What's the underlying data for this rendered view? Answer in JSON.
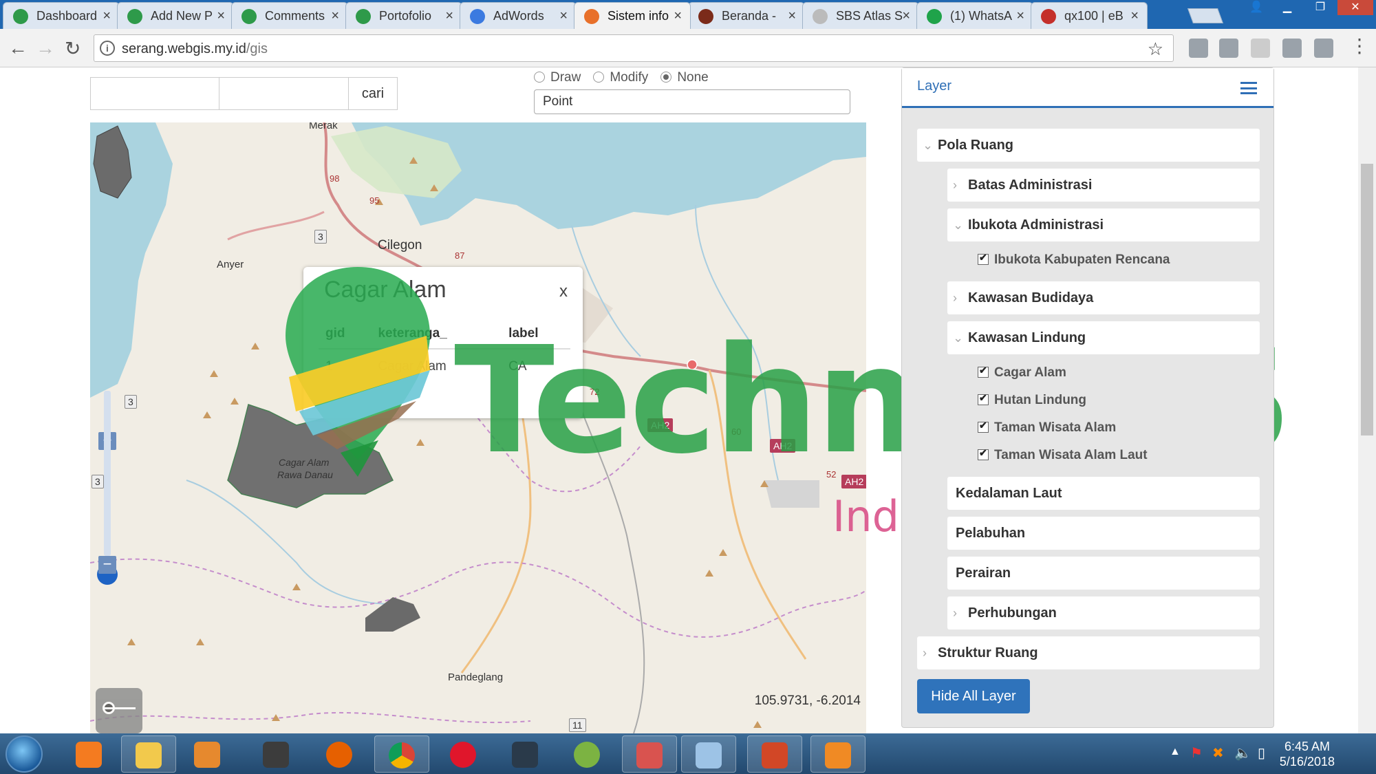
{
  "browser": {
    "tabs": [
      {
        "title": "Dashboard",
        "favicon_color": "#2e9a4a",
        "active": false
      },
      {
        "title": "Add New P",
        "favicon_color": "#2e9a4a",
        "active": false
      },
      {
        "title": "Comments",
        "favicon_color": "#2e9a4a",
        "active": false
      },
      {
        "title": "Portofolio",
        "favicon_color": "#2e9a4a",
        "active": false
      },
      {
        "title": "AdWords",
        "favicon_color": "#3b7ae0",
        "active": false
      },
      {
        "title": "Sistem info",
        "favicon_color": "#e8702a",
        "active": true
      },
      {
        "title": "Beranda -",
        "favicon_color": "#7b2b1a",
        "active": false
      },
      {
        "title": "SBS Atlas S",
        "favicon_color": "#bbbbbb",
        "active": false
      },
      {
        "title": "(1) WhatsA",
        "favicon_color": "#1fa34a",
        "active": false
      },
      {
        "title": "qx100 | eB",
        "favicon_color": "#c4302b",
        "active": false
      }
    ],
    "url_host": "serang.webgis.my.id",
    "url_path": "/gis"
  },
  "search": {
    "cari_label": "cari"
  },
  "draw": {
    "options": [
      "Draw",
      "Modify",
      "None"
    ],
    "selected": "None",
    "geometry_value": "Point"
  },
  "map": {
    "labels": {
      "merak": "Merak",
      "cilegon": "Cilegon",
      "anyer": "Anyer",
      "pandeglang": "Pandeglang",
      "cagar_line1": "Cagar Alam",
      "cagar_line2": "Rawa Danau"
    },
    "road_badges": [
      "3",
      "3",
      "3",
      "11"
    ],
    "road_numbers": [
      "98",
      "95",
      "87",
      "72",
      "60",
      "52"
    ],
    "ah_badges": [
      "AH2",
      "AH2",
      "AH2"
    ],
    "coordinates": "105.9731, -6.2014",
    "zoom_in": "+",
    "zoom_out": "−"
  },
  "popup": {
    "title": "Cagar Alam",
    "close": "x",
    "columns": [
      "gid",
      "keteranga_",
      "label"
    ],
    "rows": [
      [
        "1",
        "Cagar Alam",
        "CA"
      ]
    ]
  },
  "watermark": {
    "brand": "TechnoGIS",
    "sub": "Indonesia"
  },
  "layer_panel": {
    "title": "Layer",
    "groups": {
      "pola_ruang": "Pola Ruang",
      "batas_administrasi": "Batas Administrasi",
      "ibukota_administrasi": "Ibukota Administrasi",
      "ibukota_kabupaten_rencana": "Ibukota Kabupaten Rencana",
      "kawasan_budidaya": "Kawasan Budidaya",
      "kawasan_lindung": "Kawasan Lindung",
      "cagar_alam": "Cagar Alam",
      "hutan_lindung": "Hutan Lindung",
      "taman_wisata_alam": "Taman Wisata Alam",
      "taman_wisata_alam_laut": "Taman Wisata Alam Laut",
      "kedalaman_laut": "Kedalaman Laut",
      "pelabuhan": "Pelabuhan",
      "perairan": "Perairan",
      "perhubungan": "Perhubungan",
      "struktur_ruang": "Struktur Ruang"
    },
    "hide_all_label": "Hide All Layer"
  },
  "taskbar": {
    "time": "6:45 AM",
    "date": "5/16/2018"
  },
  "colors": {
    "tab_strip": "#1f67b1",
    "sea": "#aad3df",
    "land": "#f1ede4",
    "accent": "#2f73bb",
    "watermark_green": "#28a046",
    "watermark_pink": "#d74882"
  }
}
